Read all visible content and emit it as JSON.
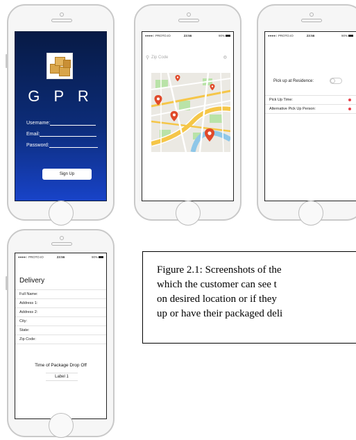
{
  "signup_screen": {
    "app_name": "G P R",
    "username_label": "Username:",
    "email_label": "Email:",
    "password_label": "Password:",
    "signup_button": "Sign Up"
  },
  "map_screen": {
    "status": {
      "carrier": "●●●●○ PROTO.IO",
      "time": "23:56",
      "battery": "90%"
    },
    "search_placeholder": "Zip Code",
    "pin_color": "#e04a2a"
  },
  "pickup_screen": {
    "status": {
      "carrier": "●●●●○ PROTO.IO",
      "time": "23:56",
      "battery": "90%"
    },
    "residence_label": "Pick up at Residence:",
    "rows": [
      "Pick Up Time:",
      "Alternative Pick Up Person:"
    ],
    "accent": "#e8414a"
  },
  "delivery_screen": {
    "status": {
      "carrier": "●●●●○ PROTO.IO",
      "time": "23:56",
      "battery": "90%"
    },
    "title": "Delivery",
    "fields": [
      "Full Name:",
      "Address 1:",
      "Address 2:",
      "City:",
      "State:",
      "Zip Code:"
    ],
    "dropoff_title": "Time of Package Drop Off",
    "dropoff_value": "Label 1"
  },
  "caption": {
    "lines": [
      "Figure 2.1: Screenshots of the",
      "which the customer can see t",
      "on desired location or if they",
      "up or have their packaged deli"
    ]
  }
}
